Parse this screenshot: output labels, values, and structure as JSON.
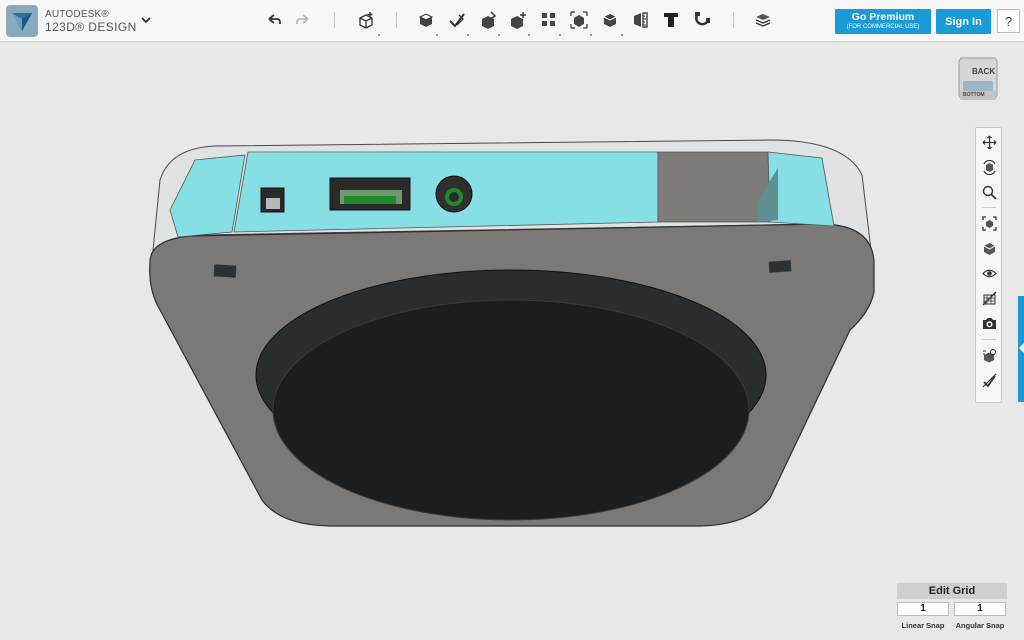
{
  "app": {
    "brand_top": "AUTODESK®",
    "brand_bottom": "123D® DESIGN"
  },
  "toolbar": {
    "undo_icon": "undo-icon",
    "redo_icon": "redo-icon",
    "tools": [
      "new-object-icon",
      "primitives-icon",
      "sketch-icon",
      "construct-icon",
      "modify-icon",
      "pattern-icon",
      "grouping-icon",
      "combine-icon",
      "measure-icon",
      "text-icon",
      "snap-icon",
      "material-icon"
    ]
  },
  "account": {
    "premium_title": "Go Premium",
    "premium_sub": "(FOR COMMERCIAL USE)",
    "signin_label": "Sign In",
    "help_label": "?"
  },
  "viewcube": {
    "face_top": "BACK",
    "face_bottom": "BOTTOM"
  },
  "navbar": {
    "tools": [
      "pan-icon",
      "orbit-icon",
      "zoom-icon",
      "fit-icon",
      "view-icon",
      "visibility-icon",
      "hide-materials-icon",
      "screenshot-icon",
      "group-visibility-icon",
      "sketch-visibility-icon"
    ]
  },
  "grid": {
    "edit_label": "Edit Grid",
    "linear_value": "1",
    "angular_value": "1",
    "linear_label": "Linear Snap",
    "angular_label": "Angular Snap"
  },
  "colors": {
    "accent": "#1a9ad6",
    "model_body": "#7b7878",
    "model_face": "#86dfe4",
    "model_dark": "#1b1d1e"
  }
}
